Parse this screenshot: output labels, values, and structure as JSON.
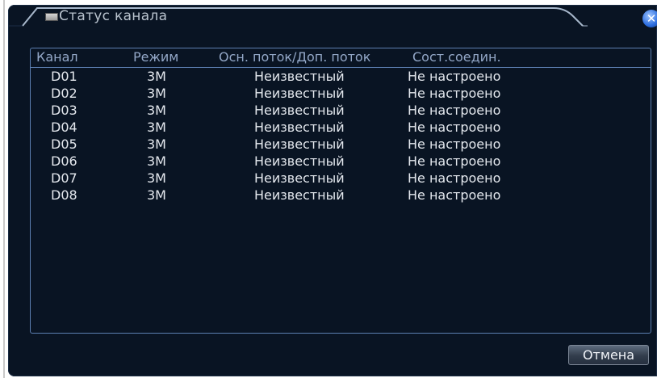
{
  "dialog": {
    "title": "Статус канала",
    "close_symbol": "✕"
  },
  "table": {
    "headers": {
      "channel": "Канал",
      "mode": "Режим",
      "stream": "Осн. поток/Доп. поток",
      "state": "Сост.соедин."
    },
    "rows": [
      {
        "channel": "D01",
        "mode": "3M",
        "stream": "Неизвестный",
        "state": "Не настроено"
      },
      {
        "channel": "D02",
        "mode": "3M",
        "stream": "Неизвестный",
        "state": "Не настроено"
      },
      {
        "channel": "D03",
        "mode": "3M",
        "stream": "Неизвестный",
        "state": "Не настроено"
      },
      {
        "channel": "D04",
        "mode": "3M",
        "stream": "Неизвестный",
        "state": "Не настроено"
      },
      {
        "channel": "D05",
        "mode": "3M",
        "stream": "Неизвестный",
        "state": "Не настроено"
      },
      {
        "channel": "D06",
        "mode": "3M",
        "stream": "Неизвестный",
        "state": "Не настроено"
      },
      {
        "channel": "D07",
        "mode": "3M",
        "stream": "Неизвестный",
        "state": "Не настроено"
      },
      {
        "channel": "D08",
        "mode": "3M",
        "stream": "Неизвестный",
        "state": "Не настроено"
      }
    ]
  },
  "buttons": {
    "cancel": "Отмена"
  },
  "icons": {
    "title": "monitor-icon",
    "close": "close-icon"
  },
  "colors": {
    "background": "#091423",
    "border": "#5c7fb1",
    "text": "#e4e8ee",
    "header_text": "#93a7c7",
    "close_accent": "#2b6de0"
  }
}
